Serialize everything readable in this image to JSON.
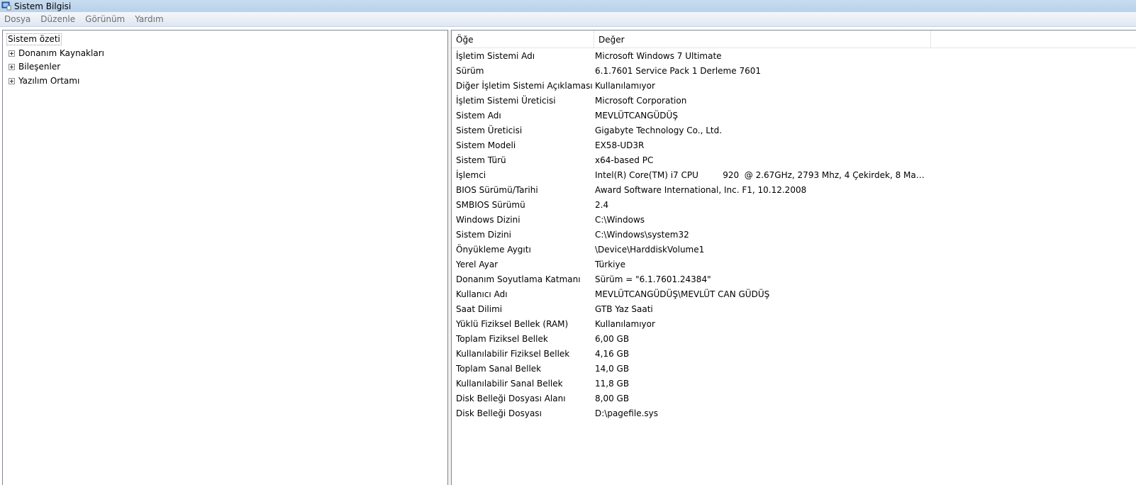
{
  "window": {
    "title": "Sistem Bilgisi"
  },
  "menu": [
    "Dosya",
    "Düzenle",
    "Görünüm",
    "Yardım"
  ],
  "tree": {
    "root": "Sistem özeti",
    "children": [
      "Donanım Kaynakları",
      "Bileşenler",
      "Yazılım Ortamı"
    ]
  },
  "table": {
    "columns": [
      "Öğe",
      "Değer"
    ],
    "rows": [
      [
        "İşletim Sistemi Adı",
        "Microsoft Windows 7 Ultimate"
      ],
      [
        "Sürüm",
        "6.1.7601 Service Pack 1 Derleme 7601"
      ],
      [
        "Diğer İşletim Sistemi Açıklaması",
        "Kullanılamıyor"
      ],
      [
        "İşletim Sistemi Üreticisi",
        "Microsoft Corporation"
      ],
      [
        "Sistem Adı",
        "MEVLÜTCANGÜDÜŞ"
      ],
      [
        "Sistem Üreticisi",
        "Gigabyte Technology Co., Ltd."
      ],
      [
        "Sistem Modeli",
        "EX58-UD3R"
      ],
      [
        "Sistem Türü",
        "x64-based PC"
      ],
      [
        "İşlemci",
        "Intel(R) Core(TM) i7 CPU         920  @ 2.67GHz, 2793 Mhz, 4 Çekirdek, 8 Mantı..."
      ],
      [
        "BIOS Sürümü/Tarihi",
        "Award Software International, Inc. F1, 10.12.2008"
      ],
      [
        "SMBIOS Sürümü",
        "2.4"
      ],
      [
        "Windows Dizini",
        "C:\\Windows"
      ],
      [
        "Sistem Dizini",
        "C:\\Windows\\system32"
      ],
      [
        "Önyükleme Aygıtı",
        "\\Device\\HarddiskVolume1"
      ],
      [
        "Yerel Ayar",
        "Türkiye"
      ],
      [
        "Donanım Soyutlama Katmanı",
        "Sürüm = \"6.1.7601.24384\""
      ],
      [
        "Kullanıcı Adı",
        "MEVLÜTCANGÜDÜŞ\\MEVLÜT CAN GÜDÜŞ"
      ],
      [
        "Saat Dilimi",
        "GTB Yaz Saati"
      ],
      [
        "Yüklü Fiziksel Bellek (RAM)",
        "Kullanılamıyor"
      ],
      [
        "Toplam Fiziksel Bellek",
        "6,00 GB"
      ],
      [
        "Kullanılabilir Fiziksel Bellek",
        "4,16 GB"
      ],
      [
        "Toplam Sanal Bellek",
        "14,0 GB"
      ],
      [
        "Kullanılabilir Sanal Bellek",
        "11,8 GB"
      ],
      [
        "Disk Belleği Dosyası Alanı",
        "8,00 GB"
      ],
      [
        "Disk Belleği Dosyası",
        "D:\\pagefile.sys"
      ]
    ]
  }
}
